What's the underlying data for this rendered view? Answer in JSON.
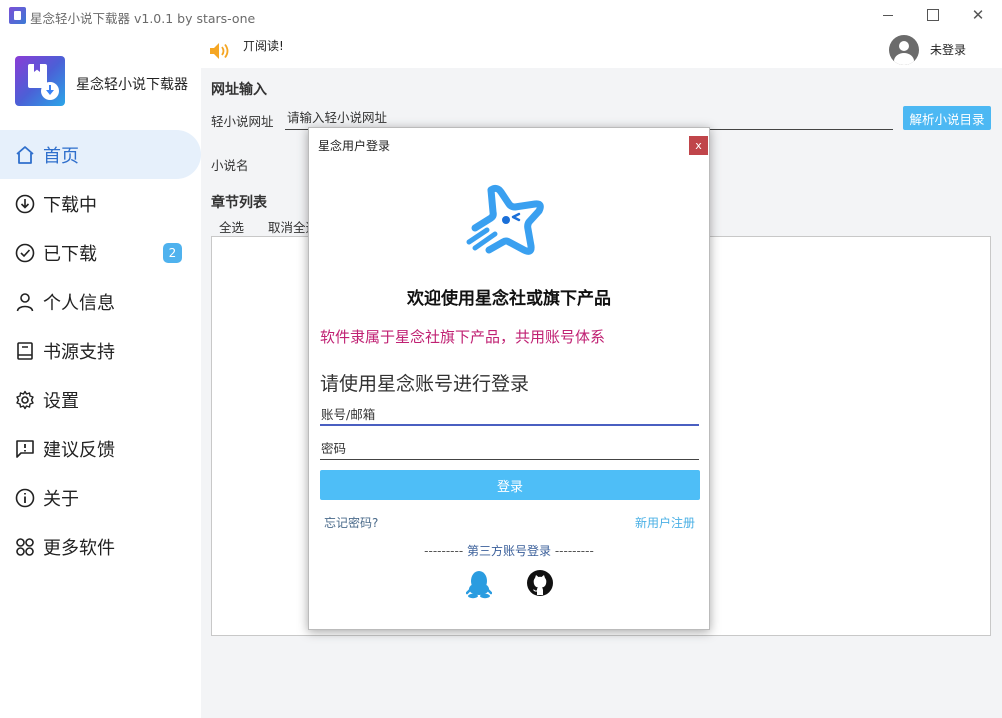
{
  "window": {
    "title": "星念轻小说下载器 v1.0.1 by stars-one"
  },
  "sidebar": {
    "brand_name": "星念轻小说下载器",
    "items": [
      {
        "label": "首页",
        "icon": "home-icon"
      },
      {
        "label": "下载中",
        "icon": "download-circle-icon"
      },
      {
        "label": "已下载",
        "icon": "check-circle-icon",
        "badge": "2"
      },
      {
        "label": "个人信息",
        "icon": "user-icon"
      },
      {
        "label": "书源支持",
        "icon": "book-icon"
      },
      {
        "label": "设置",
        "icon": "gear-icon"
      },
      {
        "label": "建议反馈",
        "icon": "feedback-icon"
      },
      {
        "label": "关于",
        "icon": "info-icon"
      },
      {
        "label": "更多软件",
        "icon": "apps-icon"
      }
    ],
    "active_index": 0
  },
  "topbar": {
    "notice": "丌阅读!",
    "user_name": "未登录"
  },
  "main": {
    "url_section_title": "网址输入",
    "url_label": "轻小说网址",
    "url_placeholder": "请输入轻小说网址",
    "parse_button": "解析小说目录",
    "novel_name_label": "小说名",
    "chapter_section_title": "章节列表",
    "select_all": "全选",
    "deselect_all": "取消全选"
  },
  "login_dialog": {
    "title": "星念用户登录",
    "close": "x",
    "welcome": "欢迎使用星念社或旗下产品",
    "subtitle": "软件隶属于星念社旗下产品，共用账号体系",
    "heading": "请使用星念账号进行登录",
    "account_placeholder": "账号/邮箱",
    "password_placeholder": "密码",
    "login_button": "登录",
    "forgot_password": "忘记密码?",
    "register": "新用户注册",
    "third_party_label": "第三方账号登录",
    "third_party_dashes": "---------"
  },
  "colors": {
    "accent": "#4ebef7",
    "active_nav_bg": "#e6f0fb",
    "active_nav_text": "#2f6fcc",
    "subtitle_pink": "#c02173",
    "close_red": "#c0454a",
    "badge_blue": "#4fb2ee"
  }
}
